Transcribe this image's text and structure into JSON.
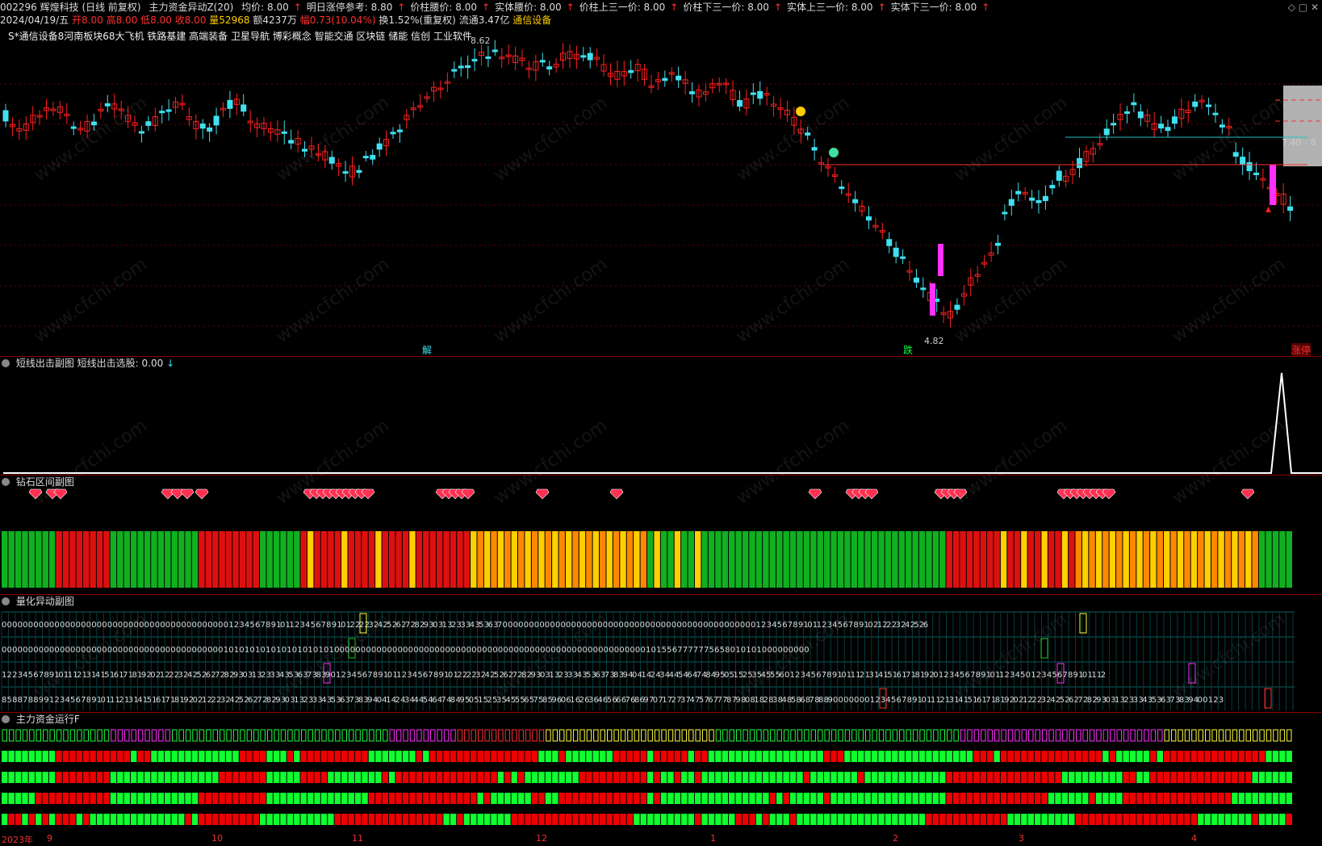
{
  "header": {
    "code_name": "002296 辉煌科技 (日线 前复权)",
    "indicator": "主力资金异动Z(20)",
    "fields": [
      "均价: 8.00",
      "明日涨停参考: 8.80",
      "价柱腰价: 8.00",
      "实体腰价: 8.00",
      "价柱上三一价: 8.00",
      "价柱下三一价: 8.00",
      "实体上三一价: 8.00",
      "实体下三一价: 8.00"
    ],
    "arrow": "↑"
  },
  "quote": {
    "date": "2024/04/19/五",
    "open": "开8.00",
    "high": "高8.00",
    "low": "低8.00",
    "close": "收8.00",
    "volume": "量52968",
    "amount": "额4237万",
    "change": "幅0.73(10.04%)",
    "turnover": "换1.52%(重复权)",
    "float": "流通3.47亿",
    "sector": "通信设备"
  },
  "concepts": "S*通信设备8河南板块68大飞机 铁路基建 高端装备 卫星导航 博彩概念 智能交通 区块链 储能 信创 工业软件",
  "main_chart": {
    "high_label": "8.62",
    "low_label": "4.82",
    "price_label": "7.40 - 8",
    "marker_jie": "解",
    "marker_die": "跌",
    "marker_zhangting": "涨停"
  },
  "panel1": {
    "title": "短线出击副图",
    "value_label": "短线出击选股: 0.00",
    "arrow": "↓"
  },
  "panel2": {
    "title": "钻石区间副图"
  },
  "panel3": {
    "title": "量化异动副图",
    "row1": "0 0 0 0 0 0 0 0 0 0 0 0 0 0 0 0 0 0 0 0 0 0 0 0 0 0 0 0 0 0 0 0 0 0 0 0 0 0 0 0 0 0 0 1 2 3 4 5 6 7 8 9 10 11 2 3 4 5 6 7 8 9 10 12 22 23 24 25 26 27 28 29 30 31 32 33 34 35 36 37 0 0 0 0 0 0 0 0 0 0 0 0 0 0 0 0 0 0 0 0 0 0 0 0 0 0 0 0 0 0 0 0 0 0 0 0 0 0 0 0 0 0 0 0 0 0 0 0 1 2 3 4 5 6 7 8 9 10 11 2 3 4 5 6 7 8 9 10 21 22 23 24 25 26",
    "row2": "0 0 0 0 0 0 0 0 0 0 0 0 0 0 0 0 0 0 0 0 0 0 0 0 0 0 0 0 0 0 0 0 0 0 0 0 0 0 0 0 0 0 1 0 1 0 1 0 1 0 1 0 1 0 1 0 1 0 1 0 1 0 1 0 0 0 0 0 0 0 0 0 0 0 0 0 0 0 0 0 0 0 0 0 0 0 0 0 0 0 0 0 0 0 0 0 0 0 0 0 0 0 0 0 0 0 0 0 0 0 0 0 0 0 0 0 0 0 0 0 0 0 1 0 1 5 5 6 7 7 7 7 7 7 5 6 5 8 0 1 0 1 0 1 0 0 0 0 0 0 0 0 0",
    "row3": "1 2 2 3 4 5 6 7 8 9 10 11 12 13 14 15 16 17 18 19 20 21 22 23 24 25 26 27 28 29 30 31 32 33 34 35 36 37 38 39 0 1 2 3 4 5 6 7 8 9 10 11 2 3 4 5 6 7 8 9 10 12 22 23 24 25 26 27 28 29 30 31 32 33 34 35 36 37 38 39 40 41 42 43 44 45 46 47 48 49 50 51 52 53 54 55 56 0 1 2 3 4 5 6 7 8 9 10 11 12 13 14 15 16 17 18 19 20 1 2 3 4 5 6 7 8 9 10 11 2 3 4 5 0 1 2 3 4 5 6 7 8 9 10 11 12",
    "row4": "8 5 8 8 7 8 8 9 9 1 2 3 4 5 6 7 8 9 10 11 12 13 14 15 16 17 18 19 20 21 22 23 24 25 26 27 28 29 30 31 32 33 34 35 36 37 38 39 40 41 42 43 44 45 46 47 48 49 50 51 52 53 54 55 56 57 58 59 60 61 62 63 64 65 66 67 68 69 70 71 72 73 74 75 76 77 78 79 80 81 82 83 84 85 86 87 88 89 0 0 0 0 0 0 0 1 2 3 4 5 6 7 8 9 10 11 12 13 14 15 16 17 18 19 20 21 22 23 24 25 26 27 28 29 30 31 32 33 34 35 36 37 38 39 40 0 1 2 3"
  },
  "panel4": {
    "title": "主力资金运行F"
  },
  "dates": [
    "2023年",
    "9",
    "10",
    "11",
    "12",
    "1",
    "2",
    "3",
    "4"
  ],
  "watermark": "www.cfchi.com",
  "colors": {
    "up": "#ff2020",
    "down": "#40e0f0",
    "ma": "#cccccc",
    "green": "#00c000",
    "red": "#dd0000",
    "yellow": "#ffcc00",
    "magenta": "#ff30ff"
  }
}
